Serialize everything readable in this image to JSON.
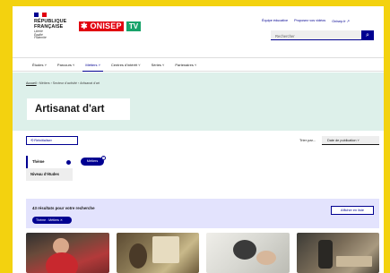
{
  "header": {
    "republique": "RÉPUBLIQUE\nFRANÇAISE",
    "motto": "Liberté\nÉgalité\nFraternité",
    "brand": "✱ ONISEP",
    "tv": "TV",
    "links": [
      "Équipe éducative",
      "Proposez vos vidéos",
      "Onisep.fr ↗"
    ],
    "search_placeholder": "Rechercher",
    "search_icon": "search-icon"
  },
  "nav": {
    "items": [
      "Études ˅",
      "Parcours ˅",
      "Métiers ˅",
      "Centres d'intérêt ˅",
      "Séries ˅",
      "Partenaires ˅"
    ],
    "active_index": 2
  },
  "hero": {
    "breadcrumb": [
      "Accueil",
      "Métiers",
      "Secteur d'activité",
      "Artisanat d'art"
    ],
    "title": "Artisanat d'art"
  },
  "filters": {
    "reset": "⟲ Réinitialiser",
    "sort_label": "Trier par...",
    "sort_value": "Date de publication ˅",
    "facets": [
      "Thème",
      "Niveau d'études"
    ],
    "active_chip": "Métiers"
  },
  "results": {
    "count_text": "43 résultats pour votre recherche",
    "tag": "Thème : Métiers ✕",
    "list_button": "Afficher en liste"
  },
  "colors": {
    "accent": "#000091",
    "brand_red": "#e1000f",
    "tv_green": "#18a36a",
    "hero_bg": "#ddf0ea"
  }
}
